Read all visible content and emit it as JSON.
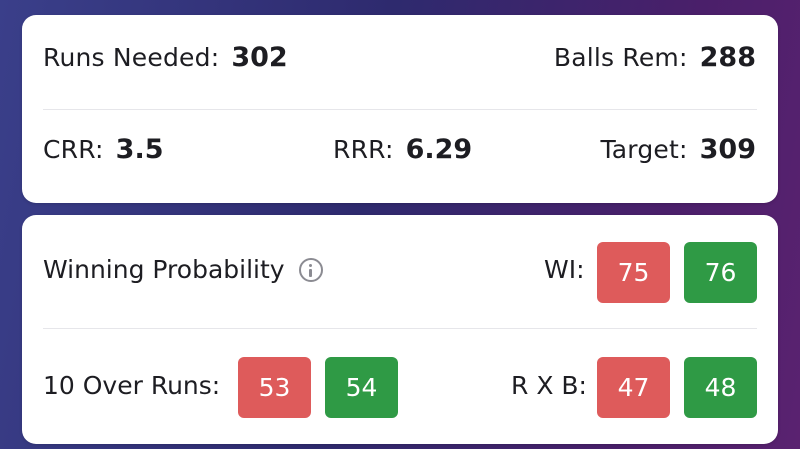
{
  "match_stats": {
    "runs_needed": {
      "label": "Runs Needed:",
      "value": "302"
    },
    "balls_rem": {
      "label": "Balls Rem:",
      "value": "288"
    },
    "crr": {
      "label": "CRR:",
      "value": "3.5"
    },
    "rrr": {
      "label": "RRR:",
      "value": "6.29"
    },
    "target": {
      "label": "Target:",
      "value": "309"
    }
  },
  "odds": {
    "winning_probability": {
      "label": "Winning Probability",
      "icon": "info-icon",
      "team_label": "WI:",
      "back": "75",
      "lay": "76"
    },
    "ten_over_runs": {
      "label": "10 Over Runs:",
      "back": "53",
      "lay": "54"
    },
    "rxb": {
      "label": "R X B:",
      "back": "47",
      "lay": "48"
    }
  },
  "colors": {
    "back": "#de5b5b",
    "lay": "#2f9a45"
  }
}
